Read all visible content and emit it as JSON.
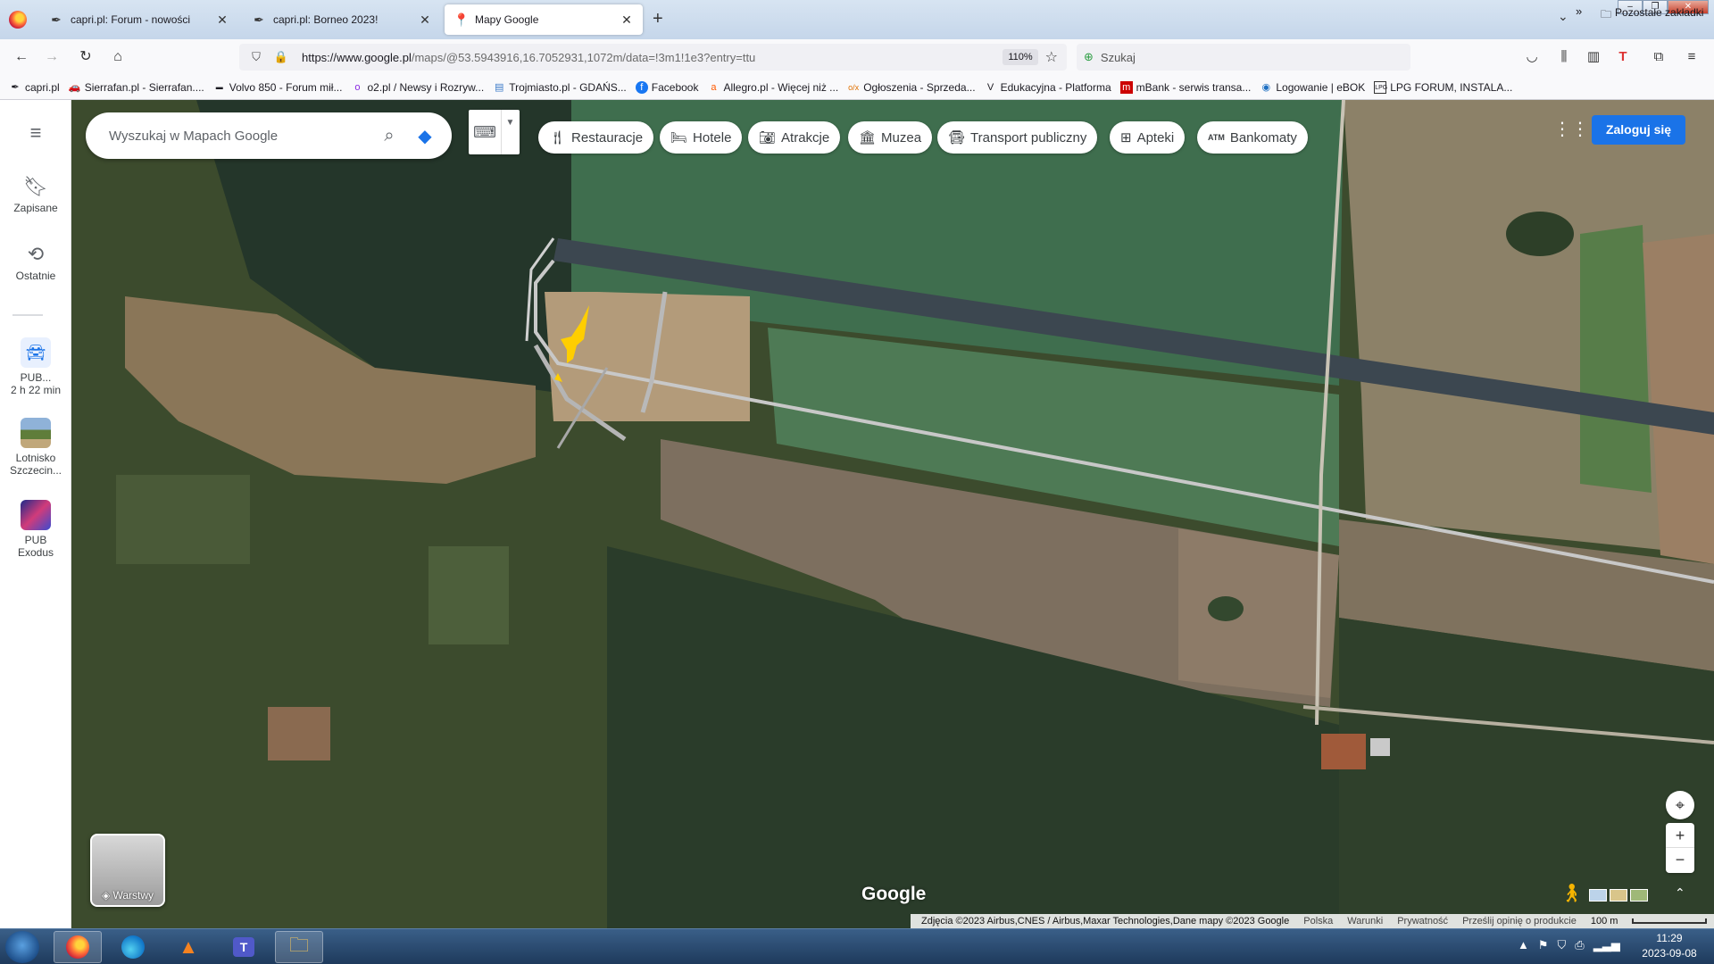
{
  "browser": {
    "tabs": [
      {
        "title": "capri.pl: Forum - nowości",
        "icon": "quill-icon"
      },
      {
        "title": "capri.pl: Borneo 2023!",
        "icon": "quill-icon"
      },
      {
        "title": "Mapy Google",
        "icon": "google-maps-pin-icon",
        "active": true
      }
    ],
    "url_host": "https://www.google.pl",
    "url_path": "/maps/@53.5943916,16.7052931,1072m/data=!3m1!1e3?entry=ttu",
    "zoom": "110%",
    "search_placeholder": "Szukaj",
    "bookmarks": [
      {
        "label": "capri.pl",
        "icon": "quill-icon"
      },
      {
        "label": "Sierrafan.pl - Sierrafan....",
        "icon": "car-icon"
      },
      {
        "label": "Volvo 850 - Forum mił...",
        "icon": "volvo-icon"
      },
      {
        "label": "o2.pl / Newsy i Rozryw...",
        "icon": "o2-icon"
      },
      {
        "label": "Trojmiasto.pl - GDAŃS...",
        "icon": "page-icon"
      },
      {
        "label": "Facebook",
        "icon": "facebook-icon"
      },
      {
        "label": "Allegro.pl - Więcej niż ...",
        "icon": "allegro-icon"
      },
      {
        "label": "Ogłoszenia - Sprzeda...",
        "icon": "olx-icon"
      },
      {
        "label": "Edukacyjna - Platforma",
        "icon": "v-icon"
      },
      {
        "label": "mBank - serwis transa...",
        "icon": "mbank-icon"
      },
      {
        "label": "Logowanie | eBOK",
        "icon": "ebok-icon"
      },
      {
        "label": "LPG FORUM, INSTALA...",
        "icon": "lpg-icon"
      }
    ],
    "bookmarks_other": "Pozostałe zakładki"
  },
  "maps": {
    "search_placeholder": "Wyszukaj w Mapach Google",
    "sidebar": {
      "saved": "Zapisane",
      "recent": "Ostatnie",
      "recent_items": [
        {
          "line1": "PUB...",
          "line2": "2 h 22 min"
        },
        {
          "line1": "Lotnisko",
          "line2": "Szczecin..."
        },
        {
          "line1": "PUB",
          "line2": "Exodus"
        }
      ]
    },
    "chips": [
      {
        "label": "Restauracje",
        "icon": "fork-knife-icon"
      },
      {
        "label": "Hotele",
        "icon": "bed-icon"
      },
      {
        "label": "Atrakcje",
        "icon": "camera-icon"
      },
      {
        "label": "Muzea",
        "icon": "museum-icon"
      },
      {
        "label": "Transport publiczny",
        "icon": "bus-icon"
      },
      {
        "label": "Apteki",
        "icon": "pharmacy-icon"
      },
      {
        "label": "Bankomaty",
        "icon": "atm-icon"
      }
    ],
    "login": "Zaloguj się",
    "layers": "Warstwy",
    "logo": "Google",
    "attribution": {
      "imagery": "Zdjęcia ©2023 Airbus,CNES / Airbus,Maxar Technologies,Dane mapy ©2023 Google",
      "country": "Polska",
      "terms": "Warunki",
      "privacy": "Prywatność",
      "feedback": "Prześlij opinię o produkcie",
      "scale": "100 m"
    }
  },
  "taskbar": {
    "apps": [
      "firefox-icon",
      "edge-icon",
      "vlc-icon",
      "teams-icon",
      "explorer-icon"
    ],
    "time": "11:29",
    "date": "2023-09-08"
  }
}
